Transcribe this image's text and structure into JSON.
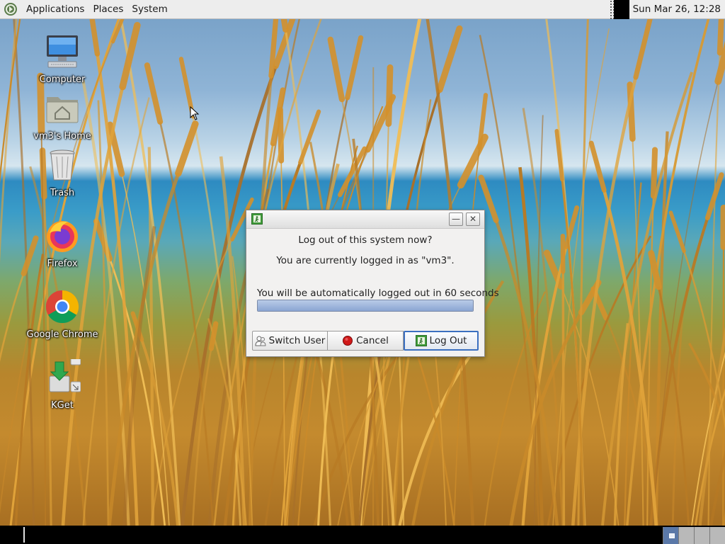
{
  "top_panel": {
    "menu": [
      "Applications",
      "Places",
      "System"
    ],
    "clock": "Sun Mar 26, 12:28"
  },
  "desktop_icons": [
    {
      "label": "Computer",
      "icon": "computer-icon"
    },
    {
      "label": "vm3's Home",
      "icon": "home-folder-icon"
    },
    {
      "label": "Trash",
      "icon": "trash-icon"
    },
    {
      "label": "Firefox",
      "icon": "firefox-icon"
    },
    {
      "label": "Google Chrome",
      "icon": "chrome-icon"
    },
    {
      "label": "KGet",
      "icon": "kget-icon"
    }
  ],
  "dialog": {
    "title_question": "Log out of this system now?",
    "user_message": "You are currently logged in as \"vm3\".",
    "timer_message": "You will be automatically logged out in 60 seconds",
    "progress_fraction": 1.0,
    "buttons": {
      "switch_user": "Switch User",
      "cancel": "Cancel",
      "logout": "Log Out"
    },
    "title_buttons": {
      "minimize": "—",
      "close": "✕"
    }
  },
  "bottom_panel": {
    "workspace_count": 4,
    "active_workspace": 1
  },
  "colors": {
    "panel_bg": "#ededed",
    "dialog_bg": "#f2f1f0",
    "focus_border": "#3b6fc0",
    "progress_fill": "#8aa5d2"
  }
}
